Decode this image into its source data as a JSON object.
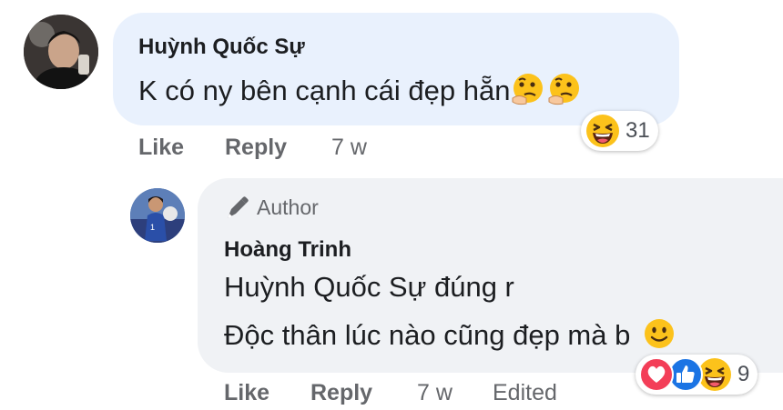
{
  "comment": {
    "author": "Huỳnh Quốc Sự",
    "text": "K có ny bên cạnh cái đẹp hẵn",
    "inline_emojis": [
      "thinking-face",
      "thinking-face"
    ],
    "reactions": {
      "icons": [
        "grinning-squinting-face"
      ],
      "count": "31"
    },
    "actions": {
      "like": "Like",
      "reply": "Reply",
      "time": "7 w"
    }
  },
  "reply": {
    "badge": "Author",
    "badge_icon": "pen-icon",
    "author": "Hoàng Trinh",
    "line1": "Huỳnh Quốc Sự đúng r",
    "line2": "Độc thân lúc nào cũng đẹp mà b",
    "inline_emojis": [
      "slightly-smiling-face"
    ],
    "reactions": {
      "icons": [
        "heart",
        "like",
        "grinning-squinting-face"
      ],
      "count": "9"
    },
    "actions": {
      "like": "Like",
      "reply": "Reply",
      "time": "7 w",
      "edited": "Edited"
    }
  },
  "colors": {
    "bubble": "#f0f2f5",
    "first_bubble": "#e9f1fd",
    "secondary_text": "#65676b",
    "heart": "#f33e58",
    "like": "#1b74e4"
  }
}
